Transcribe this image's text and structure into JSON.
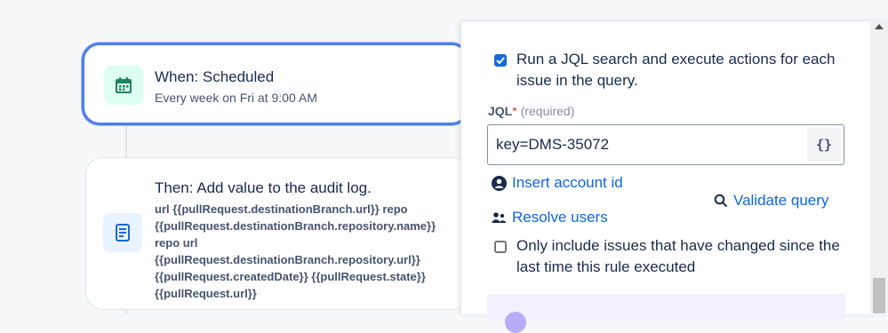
{
  "trigger": {
    "title": "When: Scheduled",
    "subtitle": "Every week on Fri at 9:00 AM",
    "icon": "calendar-icon"
  },
  "action": {
    "title": "Then: Add value to the audit log.",
    "body": "url {{pullRequest.destinationBranch.url}} repo\n{{pullRequest.destinationBranch.repository.name}}\nrepo url\n{{pullRequest.destinationBranch.repository.url}}\n{{pullRequest.createdDate}} {{pullRequest.state}}\n{{pullRequest.url}}",
    "icon": "document-icon"
  },
  "panel": {
    "run_jql_label": "Run a JQL search and execute actions for each issue in the query.",
    "run_jql_checked": true,
    "jql_label": "JQL",
    "jql_required_mark": "*",
    "jql_hint": "(required)",
    "jql_value": "key=DMS-35072",
    "smart_values_button": "{}",
    "insert_account_id": "Insert account id",
    "validate_query": "Validate query",
    "resolve_users": "Resolve users",
    "only_changed_label": "Only include issues that have changed since the last time this rule executed",
    "only_changed_checked": false
  },
  "colors": {
    "accent": "#1868db",
    "link": "#0c66e4",
    "selected_border": "#4c7ee8"
  }
}
